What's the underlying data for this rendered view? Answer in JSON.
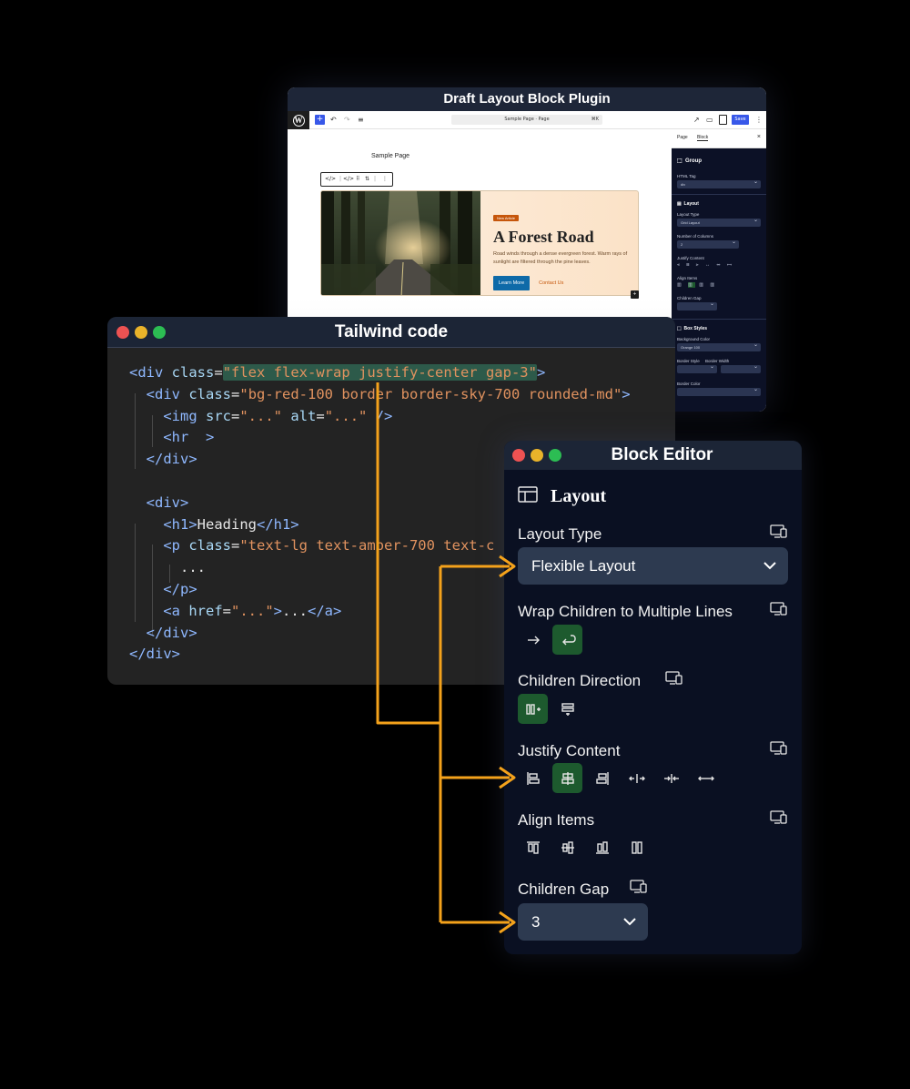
{
  "plugin": {
    "title": "Draft Layout Block Plugin",
    "doc_title": "Sample Page · Page",
    "doc_shortcut": "⌘K",
    "save_label": "Save",
    "page_label": "Sample Page",
    "card": {
      "badge": "New Article",
      "title": "A Forest Road",
      "text": "Road winds through a dense evergreen forest. Warm rays of sunlight are filtered through the pine leaves.",
      "button": "Learn More",
      "link": "Contact Us"
    },
    "sidebar": {
      "tab_page": "Page",
      "tab_block": "Block",
      "group_title": "Group",
      "html_tag_label": "HTML Tag",
      "html_tag_value": "div",
      "layout_title": "Layout",
      "layout_type_label": "Layout Type",
      "layout_type_value": "Grid Layout",
      "columns_label": "Number of Columns",
      "columns_value": "2",
      "justify_label": "Justify Content",
      "align_label": "Align Items",
      "gap_label": "Children Gap",
      "box_title": "Box Styles",
      "bg_label": "Background Color",
      "bg_value": "Orange 100",
      "border_style_label": "Border Style",
      "border_width_label": "Border Width",
      "border_color_label": "Border Color"
    }
  },
  "code": {
    "title": "Tailwind code",
    "lines": {
      "l1_open": "<div ",
      "l1_attr": "class",
      "l1_eq": "=",
      "l1_val": "\"flex flex-wrap justify-center gap-3\"",
      "l1_close": ">",
      "l2_open": "<div ",
      "l2_attr": "class",
      "l2_eq": "=",
      "l2_val": "\"bg-red-100 border border-sky-700 rounded-md\"",
      "l2_close": ">",
      "l3_open": "<img ",
      "l3_attr1": "src",
      "l3_val1": "\"...\"",
      "l3_attr2": "alt",
      "l3_val2": "\"...\"",
      "l3_close": " />",
      "l4": "<hr  >",
      "l5": "</div>",
      "l7": "<div>",
      "l8_open": "<h1>",
      "l8_text": "Heading",
      "l8_close": "</h1>",
      "l9_open": "<p ",
      "l9_attr": "class",
      "l9_eq": "=",
      "l9_val": "\"text-lg text-amber-700 text-c",
      "l10": "...",
      "l11": "</p>",
      "l12_open": "<a ",
      "l12_attr": "href",
      "l12_eq": "=",
      "l12_val": "\"...\"",
      "l12_mid": ">...",
      "l12_close": "</a>",
      "l13": "</div>",
      "l14": "</div>"
    }
  },
  "editor": {
    "title": "Block Editor",
    "section_title": "Layout",
    "layout_type_label": "Layout Type",
    "layout_type_value": "Flexible Layout",
    "wrap_label": "Wrap Children to Multiple Lines",
    "direction_label": "Children Direction",
    "justify_label": "Justify Content",
    "align_label": "Align Items",
    "gap_label": "Children Gap",
    "gap_value": "3"
  },
  "colors": {
    "accent_orange": "#f4a21b",
    "active_green": "#1d5a2e",
    "panel_bg": "#0a1022"
  }
}
